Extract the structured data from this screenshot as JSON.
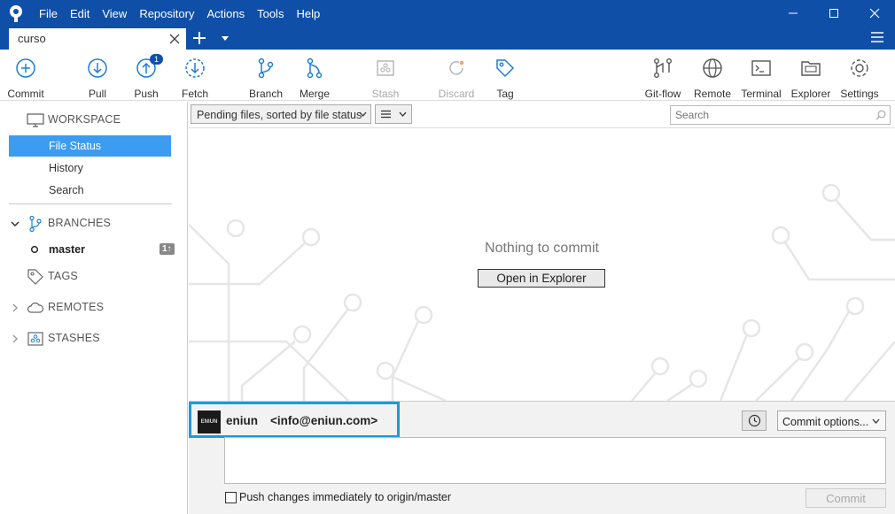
{
  "menu": [
    "File",
    "Edit",
    "View",
    "Repository",
    "Actions",
    "Tools",
    "Help"
  ],
  "tab": {
    "title": "curso"
  },
  "toolbar": {
    "commit": "Commit",
    "pull": "Pull",
    "push": "Push",
    "push_badge": "1",
    "fetch": "Fetch",
    "branch": "Branch",
    "merge": "Merge",
    "stash": "Stash",
    "discard": "Discard",
    "tag": "Tag",
    "gitflow": "Git-flow",
    "remote": "Remote",
    "terminal": "Terminal",
    "explorer": "Explorer",
    "settings": "Settings"
  },
  "sidebar": {
    "workspace": "WORKSPACE",
    "file_status": "File Status",
    "history": "History",
    "search": "Search",
    "branches": "BRANCHES",
    "master": "master",
    "master_badge": "1↑",
    "tags": "TAGS",
    "remotes": "REMOTES",
    "stashes": "STASHES"
  },
  "filter": {
    "sort": "Pending files, sorted by file status",
    "search_placeholder": "Search"
  },
  "content": {
    "empty_message": "Nothing to commit",
    "open_explorer": "Open in Explorer"
  },
  "commit": {
    "author_name": "eniun",
    "author_email": "<info@eniun.com>",
    "avatar_text": "ENIUN",
    "options": "Commit options...",
    "push_label": "Push changes immediately to origin/master",
    "commit_button": "Commit"
  },
  "colors": {
    "titlebar": "#0f4fa8",
    "selection": "#3c9cf0",
    "highlight": "#1a9bde"
  }
}
